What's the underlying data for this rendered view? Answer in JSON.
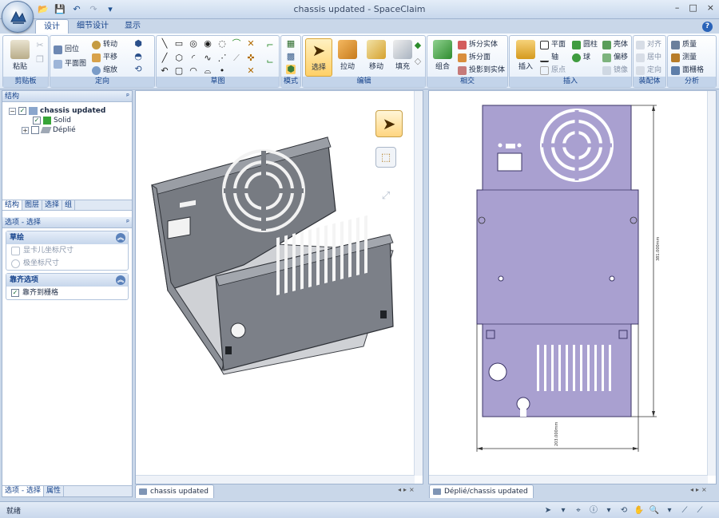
{
  "window": {
    "title": "chassis updated - SpaceClaim",
    "minimize": "–",
    "restore": "□",
    "close": "×"
  },
  "qat": {
    "open": "📂",
    "save": "💾",
    "undo": "↶",
    "redo": "↷",
    "more": "▾"
  },
  "tabs": [
    "设计",
    "细节设计",
    "显示"
  ],
  "help": "?",
  "ribbon": {
    "clipboard": {
      "label": "剪贴板",
      "paste": "粘贴"
    },
    "orient": {
      "label": "定向",
      "home": "回位",
      "plan": "平面图",
      "spin": "转动",
      "pan": "平移",
      "zoom": "缩放"
    },
    "sketch": {
      "label": "草图"
    },
    "mode": {
      "label": "模式"
    },
    "edit": {
      "label": "编辑",
      "select": "选择",
      "pull": "拉动",
      "move": "移动",
      "fill": "填充"
    },
    "intersect": {
      "label": "相交",
      "combine": "组合",
      "split_solid": "拆分实体",
      "split_face": "拆分面",
      "project": "投影到实体"
    },
    "insert": {
      "label": "插入",
      "insert": "插入",
      "plane": "平面",
      "axis": "轴",
      "point": "原点",
      "cylinder": "圆柱",
      "sphere": "球",
      "shell": "壳体",
      "offset": "偏移",
      "mirror": "镜像"
    },
    "assembly": {
      "label": "装配体",
      "align": "对齐",
      "center": "居中",
      "orient": "定向"
    },
    "analysis": {
      "label": "分析",
      "mass": "质量",
      "measure": "测量",
      "grid": "面栅格"
    }
  },
  "structure_panel": {
    "title": "结构",
    "pin": "ᵖ",
    "tree": [
      {
        "name": "chassis updated",
        "checked": true,
        "expand": "−"
      },
      {
        "name": "Solid",
        "checked": true
      },
      {
        "name": "Déplié",
        "checked": false,
        "expand": "+"
      }
    ],
    "tabs": [
      "结构",
      "图层",
      "选择",
      "组"
    ]
  },
  "options_panel": {
    "title": "选项 - 选择",
    "pin": "ᵖ",
    "sketch": {
      "header": "草绘",
      "items": [
        "显卡儿坐标尺寸",
        "极坐标尺寸"
      ]
    },
    "snap": {
      "header": "靠齐选项",
      "items": [
        "靠齐到栅格"
      ]
    },
    "collapse": "︽"
  },
  "bottom_tabs": [
    "选项 - 选择",
    "属性"
  ],
  "doc_tabs": [
    "chassis updated",
    "Déplié/chassis updated"
  ],
  "tab_nav": "◂▸×",
  "drawing": {
    "dim_vertical": "381.000mm",
    "dim_horizontal": "203.000mm"
  },
  "status": {
    "text": "就绪"
  }
}
